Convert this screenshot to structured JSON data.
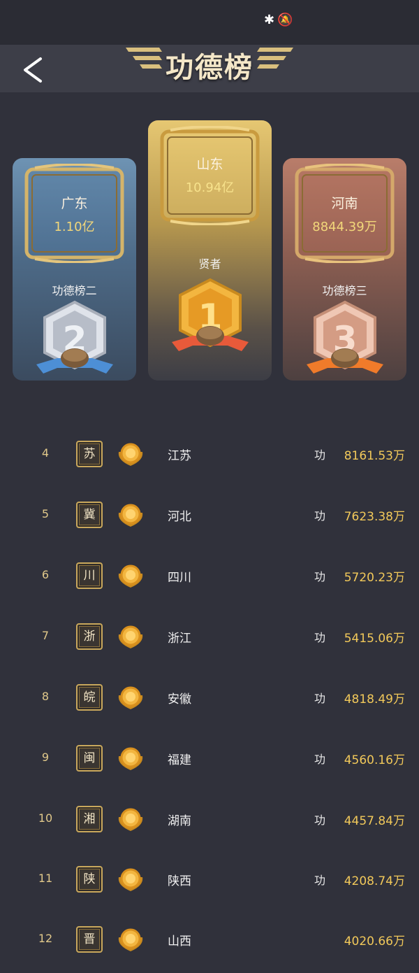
{
  "status_bar": {
    "icons": "✱🔕"
  },
  "header": {
    "title": "功德榜",
    "back_icon": "chevron-left-icon"
  },
  "podium": {
    "first": {
      "province": "山东",
      "value": "10.94亿",
      "label": "贤者",
      "rank_digit": "1",
      "color": "#e8c15a"
    },
    "second": {
      "province": "广东",
      "value": "1.10亿",
      "label": "功德榜二",
      "rank_digit": "2",
      "color": "#c9cfd8"
    },
    "third": {
      "province": "河南",
      "value": "8844.39万",
      "label": "功德榜三",
      "rank_digit": "3",
      "color": "#e7b59e"
    }
  },
  "list": [
    {
      "rank": "4",
      "seal": "苏",
      "province": "江苏",
      "gong": "功",
      "amount": "8161.53万"
    },
    {
      "rank": "5",
      "seal": "冀",
      "province": "河北",
      "gong": "功",
      "amount": "7623.38万"
    },
    {
      "rank": "6",
      "seal": "川",
      "province": "四川",
      "gong": "功",
      "amount": "5720.23万"
    },
    {
      "rank": "7",
      "seal": "浙",
      "province": "浙江",
      "gong": "功",
      "amount": "5415.06万"
    },
    {
      "rank": "8",
      "seal": "皖",
      "province": "安徽",
      "gong": "功",
      "amount": "4818.49万"
    },
    {
      "rank": "9",
      "seal": "闽",
      "province": "福建",
      "gong": "功",
      "amount": "4560.16万"
    },
    {
      "rank": "10",
      "seal": "湘",
      "province": "湖南",
      "gong": "功",
      "amount": "4457.84万"
    },
    {
      "rank": "11",
      "seal": "陕",
      "province": "陕西",
      "gong": "功",
      "amount": "4208.74万"
    },
    {
      "rank": "12",
      "seal": "晋",
      "province": "山西",
      "gong": "",
      "amount": "4020.66万"
    }
  ],
  "colors": {
    "gold_text": "#f2c95a",
    "background": "#30313b"
  }
}
